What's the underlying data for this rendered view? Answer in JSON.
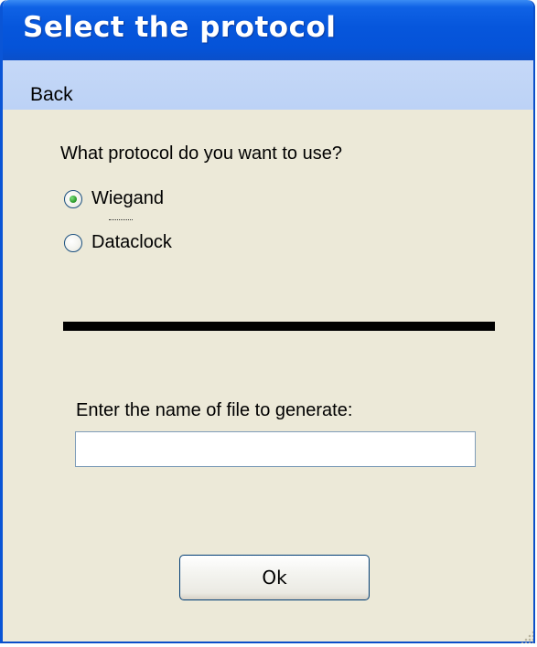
{
  "window": {
    "title": "Select the protocol"
  },
  "menu": {
    "back_label": "Back"
  },
  "protocol": {
    "question": "What protocol do you want to use?",
    "options": [
      {
        "label": "Wiegand",
        "selected": true
      },
      {
        "label": "Dataclock",
        "selected": false
      }
    ]
  },
  "file": {
    "label": "Enter the name of file to generate:",
    "value": ""
  },
  "actions": {
    "ok_label": "Ok"
  },
  "colors": {
    "titlebar": "#0553d8",
    "menubar": "#bcd2f6",
    "window_bg": "#ece9d8",
    "separator": "#000000",
    "radio_selected": "#2f9e2f"
  }
}
